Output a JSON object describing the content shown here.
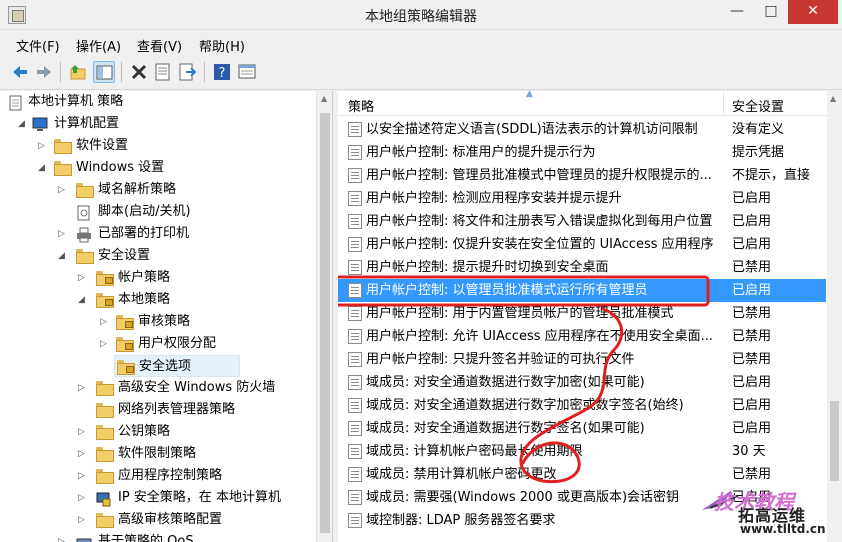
{
  "window": {
    "title": "本地组策略编辑器",
    "controls": {
      "minimize": "—",
      "maximize": "□",
      "close": "✕"
    }
  },
  "menu": [
    "文件(F)",
    "操作(A)",
    "查看(V)",
    "帮助(H)"
  ],
  "toolbar": [
    "back-icon",
    "forward-icon",
    "up-folder-icon",
    "show-hide-tree-icon",
    "delete-icon",
    "properties-icon",
    "export-icon",
    "help-icon",
    "view-icon"
  ],
  "tree": {
    "items": [
      {
        "label": "本地计算机 策略"
      },
      {
        "label": "计算机配置"
      },
      {
        "label": "软件设置"
      },
      {
        "label": "Windows 设置"
      },
      {
        "label": "域名解析策略"
      },
      {
        "label": "脚本(启动/关机)"
      },
      {
        "label": "已部署的打印机"
      },
      {
        "label": "安全设置"
      },
      {
        "label": "帐户策略"
      },
      {
        "label": "本地策略"
      },
      {
        "label": "审核策略"
      },
      {
        "label": "用户权限分配"
      },
      {
        "label": "安全选项"
      },
      {
        "label": "高级安全 Windows 防火墙"
      },
      {
        "label": "网络列表管理器策略"
      },
      {
        "label": "公钥策略"
      },
      {
        "label": "软件限制策略"
      },
      {
        "label": "应用程序控制策略"
      },
      {
        "label": "IP 安全策略，在 本地计算机"
      },
      {
        "label": "高级审核策略配置"
      },
      {
        "label": "基于策略的 QoS"
      }
    ]
  },
  "list": {
    "header_policy": "策略",
    "header_setting": "安全设置",
    "rows": [
      {
        "policy": "以安全描述符定义语言(SDDL)语法表示的计算机访问限制",
        "setting": "没有定义"
      },
      {
        "policy": "用户帐户控制: 标准用户的提升提示行为",
        "setting": "提示凭据"
      },
      {
        "policy": "用户帐户控制: 管理员批准模式中管理员的提升权限提示的...",
        "setting": "不提示，直接"
      },
      {
        "policy": "用户帐户控制: 检测应用程序安装并提示提升",
        "setting": "已启用"
      },
      {
        "policy": "用户帐户控制: 将文件和注册表写入错误虚拟化到每用户位置",
        "setting": "已启用"
      },
      {
        "policy": "用户帐户控制: 仅提升安装在安全位置的 UIAccess 应用程序",
        "setting": "已启用"
      },
      {
        "policy": "用户帐户控制: 提示提升时切换到安全桌面",
        "setting": "已禁用"
      },
      {
        "policy": "用户帐户控制: 以管理员批准模式运行所有管理员",
        "setting": "已启用"
      },
      {
        "policy": "用户帐户控制: 用于内置管理员帐户的管理员批准模式",
        "setting": "已禁用"
      },
      {
        "policy": "用户帐户控制: 允许 UIAccess 应用程序在不使用安全桌面...",
        "setting": "已禁用"
      },
      {
        "policy": "用户帐户控制: 只提升签名并验证的可执行文件",
        "setting": "已禁用"
      },
      {
        "policy": "域成员: 对安全通道数据进行数字加密(如果可能)",
        "setting": "已启用"
      },
      {
        "policy": "域成员: 对安全通道数据进行数字加密或数字签名(始终)",
        "setting": "已启用"
      },
      {
        "policy": "域成员: 对安全通道数据进行数字签名(如果可能)",
        "setting": "已启用"
      },
      {
        "policy": "域成员: 计算机帐户密码最长使用期限",
        "setting": "30 天"
      },
      {
        "policy": "域成员: 禁用计算机帐户密码更改",
        "setting": "已禁用"
      },
      {
        "policy": "域成员: 需要强(Windows 2000 或更高版本)会话密钥",
        "setting": "已启用"
      },
      {
        "policy": "域控制器: LDAP 服务器签名要求",
        "setting": ""
      }
    ]
  },
  "colors": {
    "selection": "#3399ff",
    "annotation": "#e02020",
    "close_button": "#c7372f"
  },
  "watermark": {
    "line1": "技术教程",
    "line2": "拓高运维",
    "line3": "www.tlltd.cn"
  }
}
